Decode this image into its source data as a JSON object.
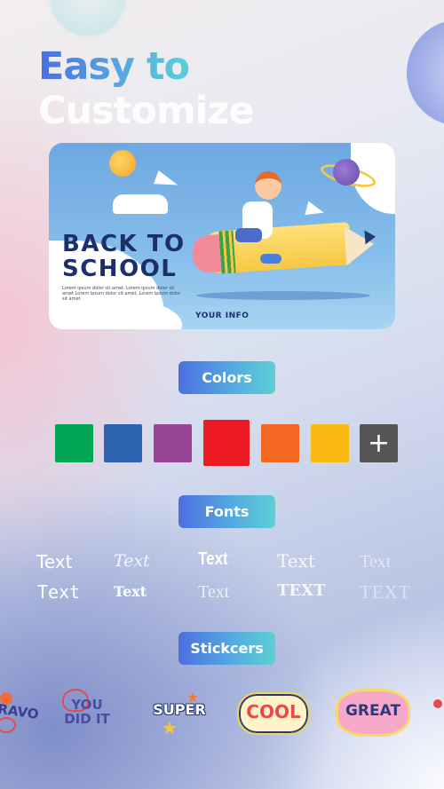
{
  "header": {
    "title_line1": "Easy to",
    "title_line2": "Customize"
  },
  "banner": {
    "headline": "BACK TO\nSCHOOL",
    "headline_line1": "BACK TO",
    "headline_line2": "SCHOOL",
    "lorem": "Lorem ipsum dolor sit amet. Lorem ipsum dolor sit amet Lorem ipsum dolor sit amet. Lorem ipsum dolor sit amet",
    "footer_text": "YOUR INFO"
  },
  "sections": {
    "colors_label": "Colors",
    "fonts_label": "Fonts",
    "stickers_label": "Stickcers"
  },
  "colors": {
    "swatches": [
      {
        "name": "green",
        "hex": "#00A651"
      },
      {
        "name": "blue",
        "hex": "#2E63AF"
      },
      {
        "name": "purple",
        "hex": "#984497"
      },
      {
        "name": "red",
        "hex": "#ED1C24",
        "selected": true
      },
      {
        "name": "orange",
        "hex": "#F26722"
      },
      {
        "name": "yellow",
        "hex": "#FDB913"
      }
    ],
    "add_symbol": "+"
  },
  "fonts": {
    "samples": [
      "Text",
      "Text",
      "Text",
      "Text",
      "Text",
      "Text",
      "Text",
      "Text",
      "TEXT",
      "TEXT"
    ]
  },
  "stickers": {
    "items": [
      "BRAVO",
      "YOU DID IT",
      "SUPER",
      "COOL",
      "GREAT",
      ""
    ]
  }
}
